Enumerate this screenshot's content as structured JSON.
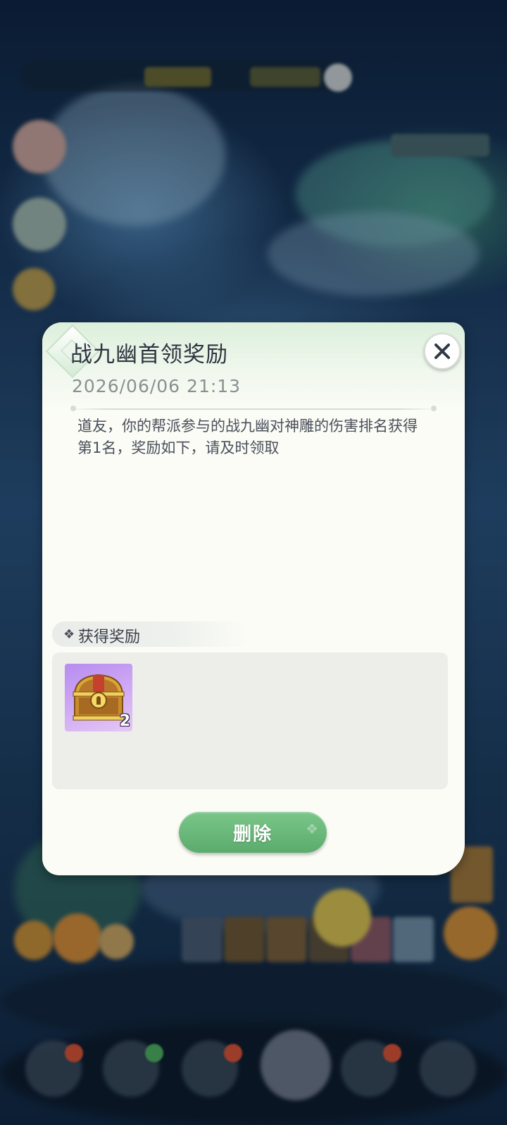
{
  "mail": {
    "title": "战九幽首领奖励",
    "datetime": "2026/06/06 21:13",
    "message": "道友，你的帮派参与的战九幽对神雕的伤害排名获得第1名，奖励如下，请及时领取",
    "reward_section_title": "获得奖励",
    "rewards": [
      {
        "icon": "treasure-chest-icon",
        "count": "2",
        "rarity_color": "#b68cf0"
      }
    ],
    "delete_label": "删除"
  },
  "icons": {
    "close": "close-icon",
    "title_decoration": "diamond-icon",
    "section_marker": "sparkle-icon"
  },
  "colors": {
    "dialog_bg": "#fbfcf6",
    "button_green": "#5aac6c",
    "reward_panel": "#ededea"
  }
}
